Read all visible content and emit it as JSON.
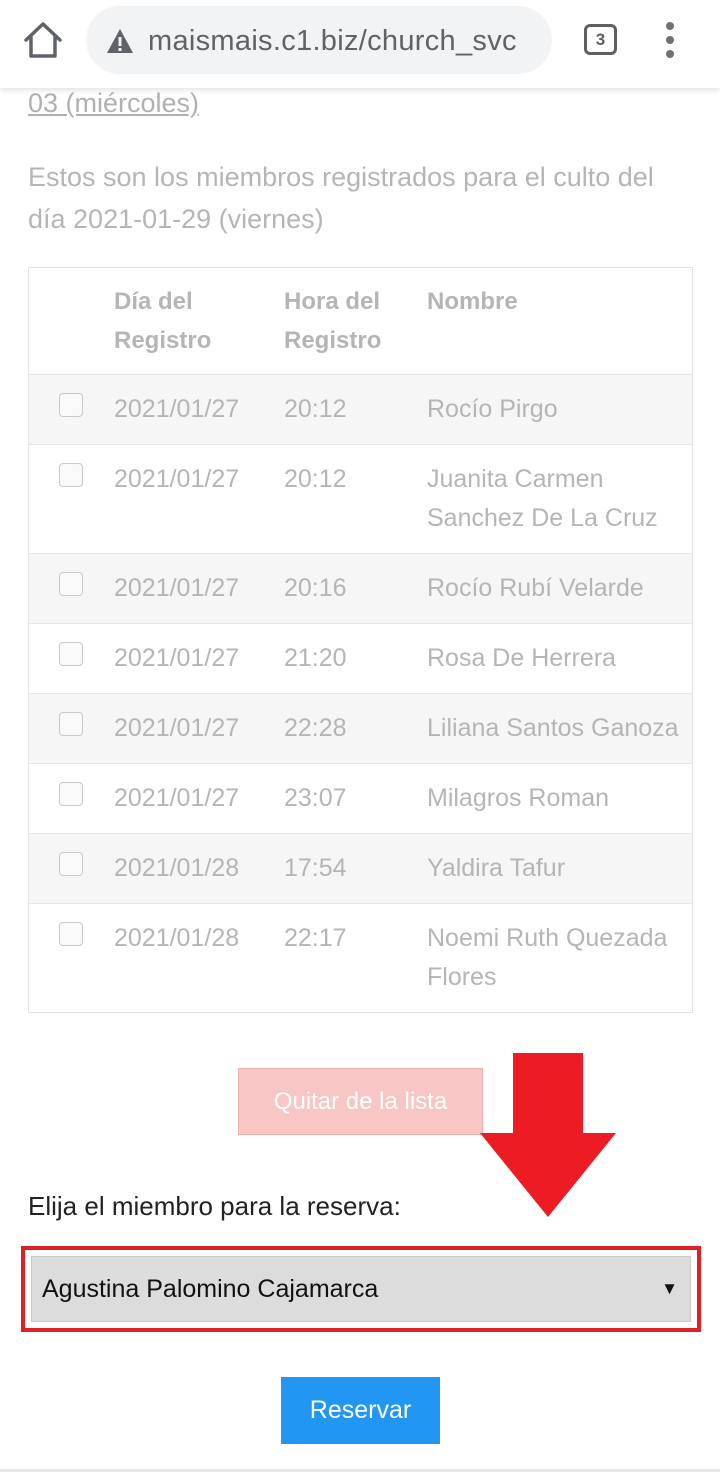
{
  "browser": {
    "url": "maismais.c1.biz/church_svc",
    "tab_count": "3",
    "icons": [
      "home-icon",
      "warning-icon",
      "tabs-icon",
      "more-vert-icon"
    ]
  },
  "content": {
    "link_date": "03 (miércoles)",
    "intro": "Estos son los miembros registrados para el culto del día 2021-01-29 (viernes)"
  },
  "table": {
    "headers": [
      "Día del Registro",
      "Hora del Registro",
      "Nombre"
    ],
    "rows": [
      {
        "date": "2021/01/27",
        "time": "20:12",
        "name": "Rocío Pirgo"
      },
      {
        "date": "2021/01/27",
        "time": "20:12",
        "name": "Juanita Carmen Sanchez De La Cruz"
      },
      {
        "date": "2021/01/27",
        "time": "20:16",
        "name": "Rocío Rubí Velarde"
      },
      {
        "date": "2021/01/27",
        "time": "21:20",
        "name": "Rosa De Herrera"
      },
      {
        "date": "2021/01/27",
        "time": "22:28",
        "name": "Liliana Santos Ganoza"
      },
      {
        "date": "2021/01/27",
        "time": "23:07",
        "name": "Milagros Roman"
      },
      {
        "date": "2021/01/28",
        "time": "17:54",
        "name": "Yaldira Tafur"
      },
      {
        "date": "2021/01/28",
        "time": "22:17",
        "name": "Noemi Ruth Quezada Flores"
      }
    ]
  },
  "actions": {
    "remove_label": "Quitar de la lista",
    "choose_label": "Elija el miembro para la reserva:",
    "selected_member": "Agustina Palomino Cajamarca",
    "reserve_label": "Reservar"
  },
  "colors": {
    "accent_blue": "#2196f3",
    "remove_pink": "#f8c6c4",
    "highlight_red": "#dd2227"
  }
}
